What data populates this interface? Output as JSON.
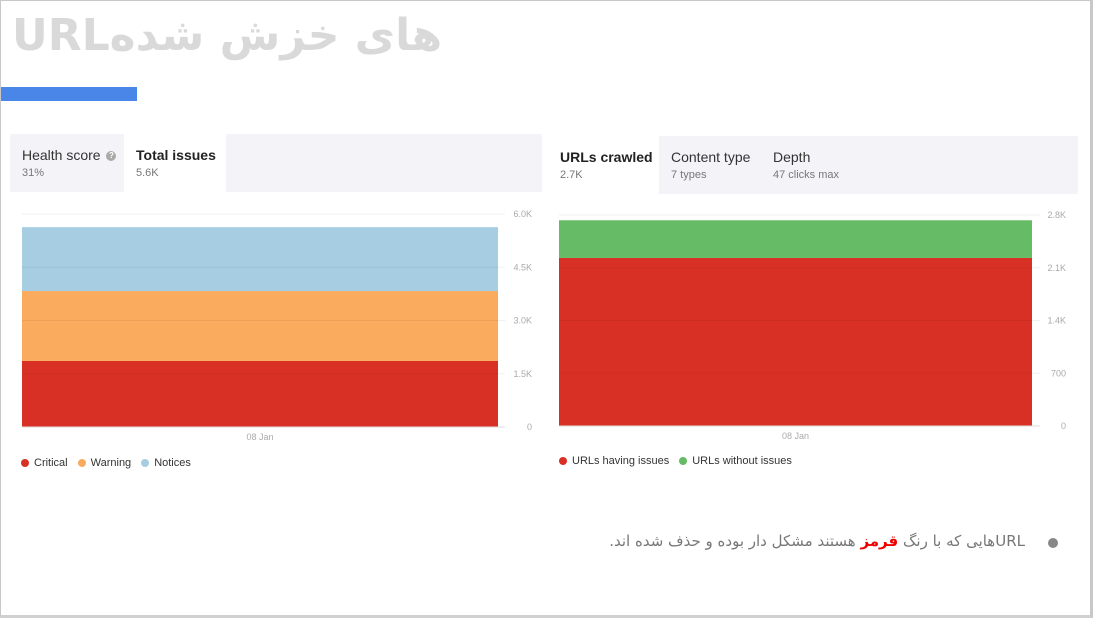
{
  "title": "URLهای خزش شده",
  "accent_color": "#4a86e8",
  "left_panel": {
    "tabs": [
      {
        "label": "Health score",
        "value": "31%",
        "active": false,
        "help": "?"
      },
      {
        "label": "Total issues",
        "value": "5.6K",
        "active": true
      }
    ]
  },
  "right_panel": {
    "tabs": [
      {
        "label": "URLs crawled",
        "value": "2.7K",
        "active": true
      },
      {
        "label": "Content type",
        "value": "7 types",
        "active": false
      },
      {
        "label": "Depth",
        "value": "47 clicks max",
        "active": false
      }
    ]
  },
  "chart_data": [
    {
      "type": "bar",
      "stacked": true,
      "categories": [
        "08 Jan"
      ],
      "series": [
        {
          "name": "Critical",
          "values": [
            1860
          ],
          "color": "#d93025"
        },
        {
          "name": "Warning",
          "values": [
            1970
          ],
          "color": "#fbab5e"
        },
        {
          "name": "Notices",
          "values": [
            1800
          ],
          "color": "#a6cde2"
        }
      ],
      "ylim": [
        0,
        6000
      ],
      "yticks": [
        "0",
        "1.5K",
        "3.0K",
        "4.5K",
        "6.0K"
      ],
      "ytick_values": [
        0,
        1500,
        3000,
        4500,
        6000
      ],
      "xlabel": "",
      "ylabel": "",
      "grid": true,
      "legend": "bottom-left"
    },
    {
      "type": "bar",
      "stacked": true,
      "categories": [
        "08 Jan"
      ],
      "series": [
        {
          "name": "URLs having issues",
          "values": [
            2230
          ],
          "color": "#d93025"
        },
        {
          "name": "URLs without issues",
          "values": [
            500
          ],
          "color": "#66bb66"
        }
      ],
      "ylim": [
        0,
        2800
      ],
      "yticks": [
        "0",
        "700",
        "1.4K",
        "2.1K",
        "2.8K"
      ],
      "ytick_values": [
        0,
        700,
        1400,
        2100,
        2800
      ],
      "xlabel": "",
      "ylabel": "",
      "grid": true,
      "legend": "bottom-left"
    }
  ],
  "note": {
    "before": "URLهایی که با رنگ ",
    "highlight": "قرمز",
    "after": " هستند مشکل دار بوده و حذف شده اند."
  }
}
